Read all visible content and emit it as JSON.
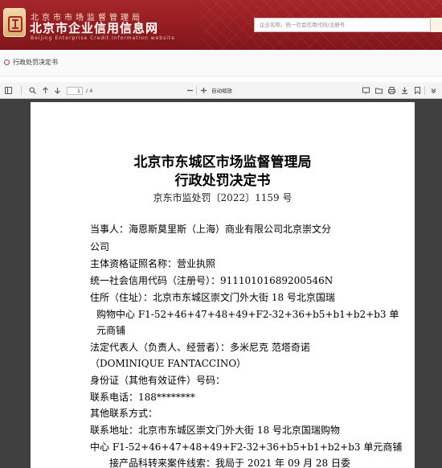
{
  "header": {
    "site_top": "北京市市场监督管理局",
    "site_name": "北京市企业信用信息网",
    "site_sub": "Beijing Enterprise Credit Information website",
    "search_placeholder": "企业名称、统一社会信用代码/注册号",
    "brand_color": "#9c2125"
  },
  "breadcrumb": {
    "label": "行政处罚决定书"
  },
  "pdf_toolbar": {
    "page_current": "1",
    "page_total": "/ 4",
    "zoom": "自动缩放"
  },
  "document": {
    "authority": "北京市东城区市场监督管理局",
    "doc_type": "行政处罚决定书",
    "doc_number": "京东市监处罚〔2022〕1159 号",
    "lines": [
      "当事人：海恩斯莫里斯（上海）商业有限公司北京崇文分",
      "公司",
      "主体资格证照名称：营业执照",
      "统一社会信用代码（注册号）：91110101689200546N",
      "住所（住址）：北京市东城区崇文门外大街 18 号北京国瑞",
      "购物中心 F1-52+46+47+48+49+F2-32+36+b5+b1+b2+b3 单",
      "元商铺",
      "法定代表人（负责人、经营者）：多米尼克          范塔奇诺",
      "（DOMINIQUE FANTACCINO）",
      "身份证（其他有效证件）号码：",
      "联系电话：188********",
      "其他联系方式：",
      "联系地址：北京市东城区崇文门外大街 18 号北京国瑞购物",
      "中心 F1-52+46+47+48+49+F2-32+36+b5+b1+b2+b3 单元商铺",
      "接产品科转来案件线索：我局于 2021 年 09 月 28 日委"
    ]
  }
}
